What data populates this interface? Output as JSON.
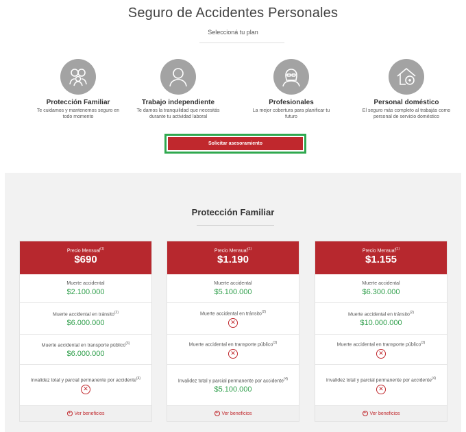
{
  "header": {
    "title": "Seguro de Accidentes Personales",
    "subtitle": "Seleccioná tu plan"
  },
  "plans": [
    {
      "name": "Protección Familiar",
      "desc": "Te cuidamos y mantenemos seguro en todo momento",
      "icon": "family-icon"
    },
    {
      "name": "Trabajo independiente",
      "desc": "Te damos la tranquilidad que necesitás durante tu actividad laboral",
      "icon": "worker-icon"
    },
    {
      "name": "Profesionales",
      "desc": "La mejor cobertura para planificar tu futuro",
      "icon": "professional-icon"
    },
    {
      "name": "Personal doméstico",
      "desc": "El seguro más completo al trabajás como personal de servicio doméstico",
      "icon": "house-icon"
    }
  ],
  "cta": {
    "label": "Solicitar asesoramiento"
  },
  "section": {
    "title": "Protección Familiar"
  },
  "cards": [
    {
      "price_label": "Precio Mensual",
      "price_sup": "(1)",
      "price": "$690",
      "rows": [
        {
          "label": "Muerte accidental",
          "sup": "",
          "value": "$2.100.000"
        },
        {
          "label": "Muerte accidental en tránsito",
          "sup": "(2)",
          "value": "$6.000.000"
        },
        {
          "label": "Muerte accidental en transporte público",
          "sup": "(3)",
          "value": "$6.000.000"
        },
        {
          "label": "Invalidez total y parcial permanente por accidente",
          "sup": "(4)",
          "value": ""
        }
      ],
      "footer": "Ver beneficios"
    },
    {
      "price_label": "Precio Mensual",
      "price_sup": "(1)",
      "price": "$1.190",
      "rows": [
        {
          "label": "Muerte accidental",
          "sup": "",
          "value": "$5.100.000"
        },
        {
          "label": "Muerte accidental en tránsito",
          "sup": "(2)",
          "value": ""
        },
        {
          "label": "Muerte accidental en transporte público",
          "sup": "(3)",
          "value": ""
        },
        {
          "label": "Invalidez total y parcial permanente por accidente",
          "sup": "(4)",
          "value": "$5.100.000"
        }
      ],
      "footer": "Ver beneficios"
    },
    {
      "price_label": "Precio Mensual",
      "price_sup": "(1)",
      "price": "$1.155",
      "rows": [
        {
          "label": "Muerte accidental",
          "sup": "",
          "value": "$6.300.000"
        },
        {
          "label": "Muerte accidental en tránsito",
          "sup": "(2)",
          "value": "$10.000.000"
        },
        {
          "label": "Muerte accidental en transporte público",
          "sup": "(3)",
          "value": ""
        },
        {
          "label": "Invalidez total y parcial permanente por accidente",
          "sup": "(4)",
          "value": ""
        }
      ],
      "footer": "Ver beneficios"
    }
  ],
  "colors": {
    "brand_red": "#b7282e",
    "value_green": "#2e9e4a",
    "highlight_green": "#2fa84f"
  }
}
